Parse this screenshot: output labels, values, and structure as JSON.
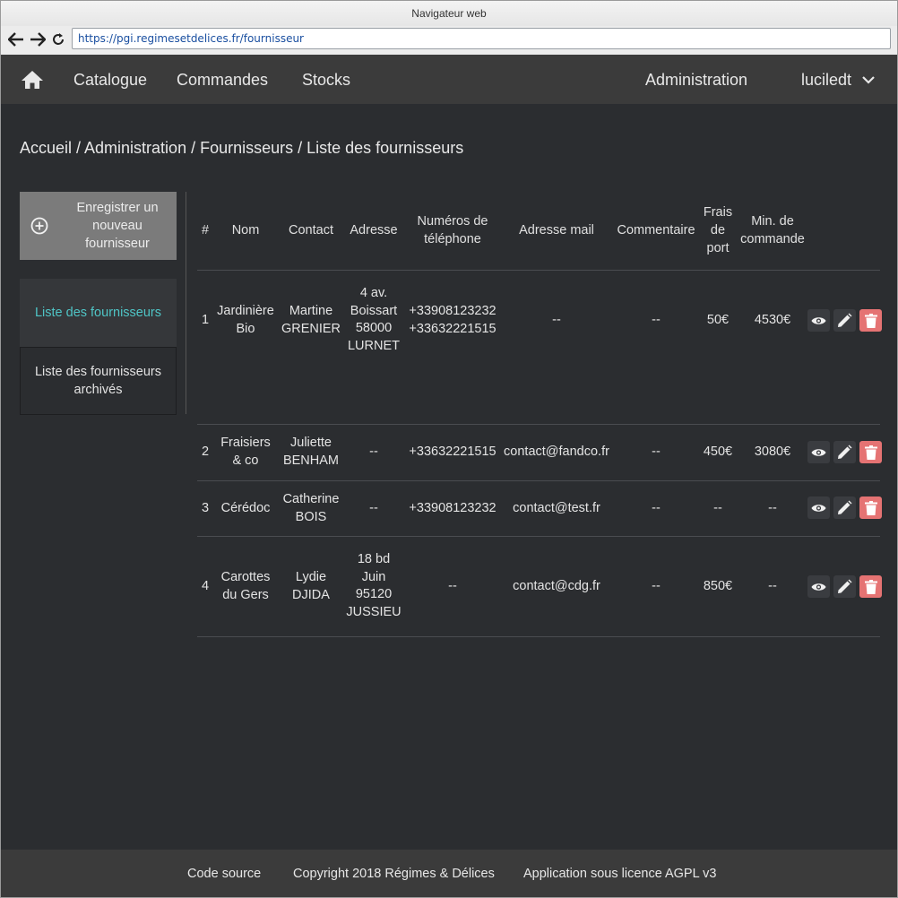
{
  "browser": {
    "window_title": "Navigateur web",
    "url": "https://pgi.regimesetdelices.fr/fournisseur"
  },
  "nav": {
    "home_icon": "home-icon",
    "catalogue": "Catalogue",
    "commandes": "Commandes",
    "stocks": "Stocks",
    "administration": "Administration",
    "user": "luciledt"
  },
  "breadcrumb": "Accueil / Administration / Fournisseurs / Liste des fournisseurs",
  "sidebar": {
    "add_button": "Enregistrer un nouveau fournisseur",
    "items": [
      {
        "label": "Liste des fournisseurs",
        "active": true
      },
      {
        "label": "Liste des fournisseurs archivés",
        "active": false
      }
    ]
  },
  "table": {
    "headers": {
      "num": "#",
      "nom": "Nom",
      "contact": "Contact",
      "adresse": "Adresse",
      "tel": "Numéros de téléphone",
      "mail": "Adresse mail",
      "commentaire": "Commentaire",
      "frais": "Frais de port",
      "min": "Min. de commande"
    },
    "rows": [
      {
        "num": "1",
        "nom": "Jardinière Bio",
        "contact": "Martine GRENIER",
        "adresse": "4 av. Boissart 58000 LURNET",
        "tel": "+33908123232 +33632221515",
        "mail": "--",
        "commentaire": "--",
        "frais": "50€",
        "min": "4530€"
      },
      {
        "num": "2",
        "nom": "Fraisiers & co",
        "contact": "Juliette BENHAM",
        "adresse": "--",
        "tel": "+33632221515",
        "mail": "contact@fandco.fr",
        "commentaire": "--",
        "frais": "450€",
        "min": "3080€"
      },
      {
        "num": "3",
        "nom": "Cérédoc",
        "contact": "Catherine BOIS",
        "adresse": "--",
        "tel": "+33908123232",
        "mail": "contact@test.fr",
        "commentaire": "--",
        "frais": "--",
        "min": "--"
      },
      {
        "num": "4",
        "nom": "Carottes du Gers",
        "contact": "Lydie DJIDA",
        "adresse": "18 bd Juin 95120 JUSSIEU",
        "tel": "--",
        "mail": "contact@cdg.fr",
        "commentaire": "--",
        "frais": "850€",
        "min": "--"
      }
    ]
  },
  "footer": {
    "source": "Code source",
    "copyright": "Copyright 2018 Régimes & Délices",
    "license": "Application sous licence AGPL v3"
  },
  "colors": {
    "background": "#2b2d30",
    "nav": "#3b3b3b",
    "accent": "#4fc5c6",
    "delete": "#e57373"
  }
}
